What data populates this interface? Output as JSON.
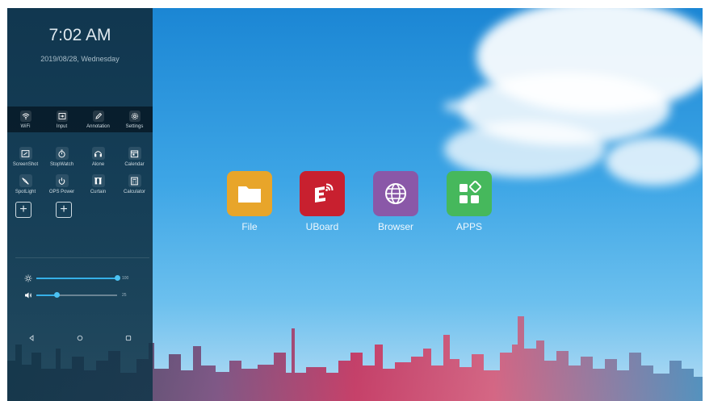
{
  "panel": {
    "time": "7:02 AM",
    "date": "2019/08/28, Wednesday",
    "quick": [
      {
        "label": "WiFi",
        "icon": "wifi-icon"
      },
      {
        "label": "Input",
        "icon": "input-icon"
      },
      {
        "label": "Annotation",
        "icon": "pen-icon"
      },
      {
        "label": "Settings",
        "icon": "gear-icon"
      }
    ],
    "tools_row1": [
      {
        "label": "ScreenShot",
        "icon": "screenshot-icon"
      },
      {
        "label": "StopWatch",
        "icon": "stopwatch-icon"
      },
      {
        "label": "Alone",
        "icon": "headphones-icon"
      },
      {
        "label": "Calendar",
        "icon": "calendar-icon"
      }
    ],
    "tools_row2": [
      {
        "label": "SpotLight",
        "icon": "spotlight-icon"
      },
      {
        "label": "OPS Power",
        "icon": "power-icon"
      },
      {
        "label": "Curtain",
        "icon": "curtain-icon"
      },
      {
        "label": "Calculator",
        "icon": "calculator-icon"
      }
    ],
    "add_button": "+",
    "brightness": {
      "value_label": "100",
      "level": 1.0
    },
    "volume": {
      "value_label": "25",
      "level": 0.25
    },
    "accent": "#36b0e8"
  },
  "apps": [
    {
      "label": "File",
      "color": "#e8a52a",
      "icon": "folder-icon"
    },
    {
      "label": "UBoard",
      "color": "#c8202f",
      "icon": "uboard-icon"
    },
    {
      "label": "Browser",
      "color": "#8a58a8",
      "icon": "globe-icon"
    },
    {
      "label": "APPS",
      "color": "#46b85c",
      "icon": "apps-grid-icon"
    }
  ]
}
